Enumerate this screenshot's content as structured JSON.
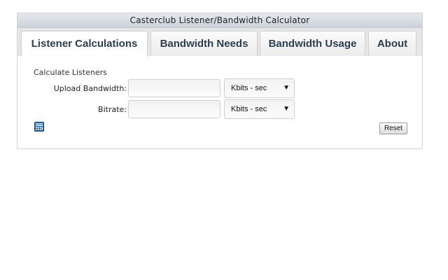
{
  "app": {
    "title": "Casterclub Listener/Bandwidth Calculator"
  },
  "tabs": [
    {
      "label": "Listener Calculations",
      "active": true
    },
    {
      "label": "Bandwidth Needs",
      "active": false
    },
    {
      "label": "Bandwidth Usage",
      "active": false
    },
    {
      "label": "About",
      "active": false
    }
  ],
  "form": {
    "section_title": "Calculate Listeners",
    "upload_bandwidth": {
      "label": "Upload Bandwidth:",
      "value": "",
      "unit": "Kbits - sec"
    },
    "bitrate": {
      "label": "Bitrate:",
      "value": "",
      "unit": "Kbits - sec"
    }
  },
  "actions": {
    "reset_label": "Reset",
    "calculator_icon": "calculator-icon"
  },
  "colors": {
    "tab_text": "#2b3e4f",
    "icon_blue": "#2a6db5"
  }
}
